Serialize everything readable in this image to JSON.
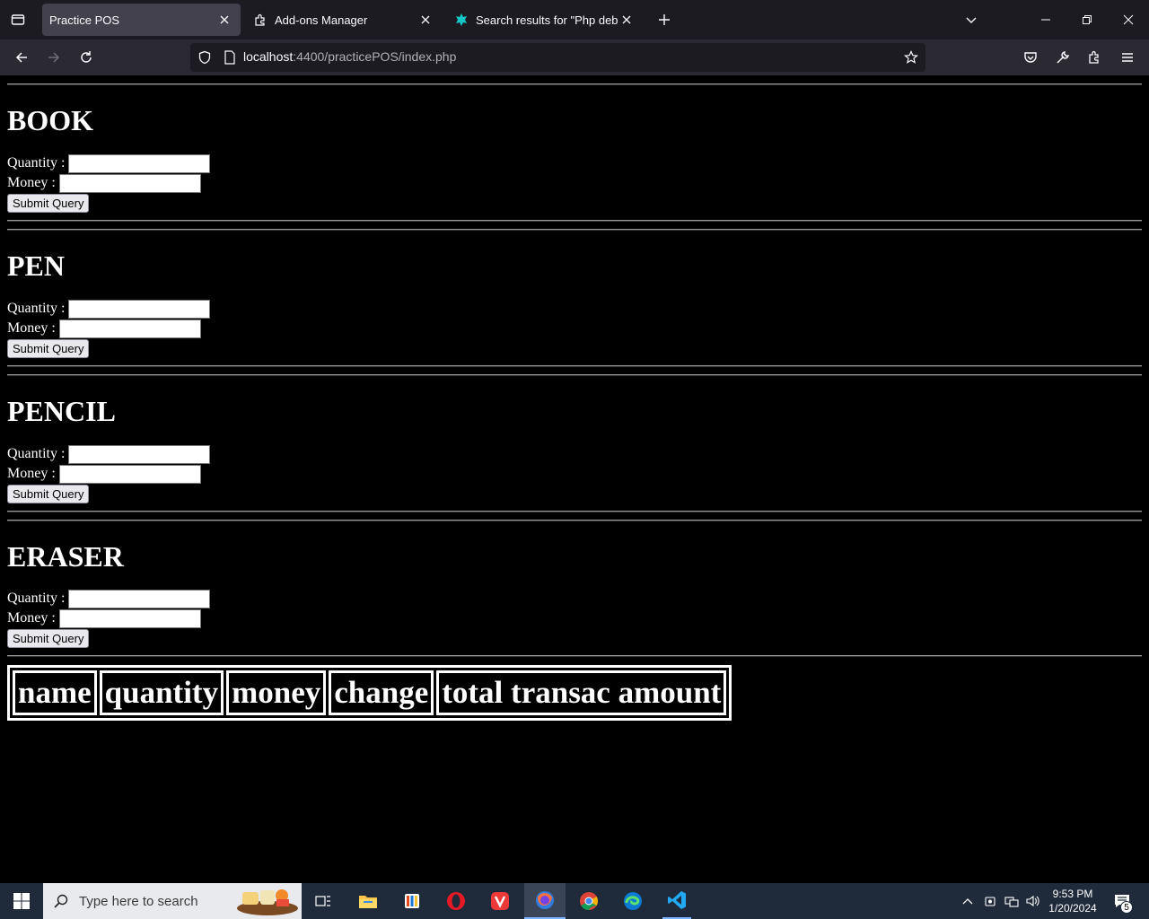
{
  "browser": {
    "tabs": [
      {
        "title": "Practice POS",
        "active": true
      },
      {
        "title": "Add-ons Manager",
        "active": false
      },
      {
        "title": "Search results for \"Php debugg",
        "active": false
      }
    ],
    "url": {
      "host": "localhost",
      "rest": ":4400/practicePOS/index.php"
    }
  },
  "page": {
    "products": [
      {
        "name": "BOOK",
        "quantity_label": "Quantity :",
        "money_label": "Money :",
        "submit_label": "Submit Query",
        "quantity_value": "",
        "money_value": ""
      },
      {
        "name": "PEN",
        "quantity_label": "Quantity :",
        "money_label": "Money :",
        "submit_label": "Submit Query",
        "quantity_value": "",
        "money_value": ""
      },
      {
        "name": "PENCIL",
        "quantity_label": "Quantity :",
        "money_label": "Money :",
        "submit_label": "Submit Query",
        "quantity_value": "",
        "money_value": ""
      },
      {
        "name": "ERASER",
        "quantity_label": "Quantity :",
        "money_label": "Money :",
        "submit_label": "Submit Query",
        "quantity_value": "",
        "money_value": ""
      }
    ],
    "table_headers": [
      "name",
      "quantity",
      "money",
      "change",
      "total transac amount"
    ]
  },
  "taskbar": {
    "search_placeholder": "Type here to search",
    "time": "9:53 PM",
    "date": "1/20/2024",
    "notification_count": "5"
  },
  "colors": {
    "page_background": "#000000",
    "text": "#ffffff",
    "tabbar": "#1c1b22",
    "navbar": "#2b2a33",
    "taskbar": "#1f2a3a"
  }
}
